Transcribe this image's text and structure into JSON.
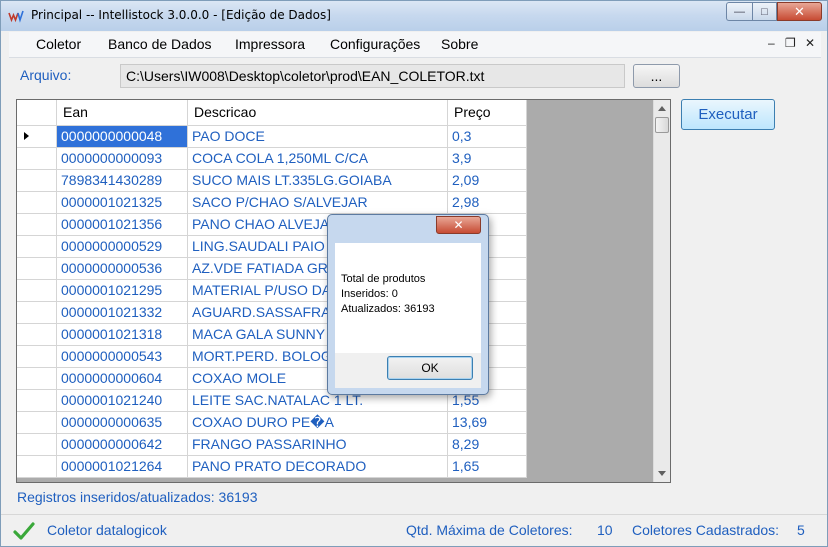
{
  "window": {
    "title": "Principal -- Intellistock 3.0.0.0 - [Edição de Dados]"
  },
  "menu": [
    "Coletor",
    "Banco de Dados",
    "Impressora",
    "Configurações",
    "Sobre"
  ],
  "file": {
    "label": "Arquivo:",
    "path": "C:\\Users\\IW008\\Desktop\\coletor\\prod\\EAN_COLETOR.txt",
    "browse_label": "..."
  },
  "execute_label": "Executar",
  "grid": {
    "columns": [
      "Ean",
      "Descricao",
      "Preço"
    ],
    "rows": [
      {
        "ean": "0000000000048",
        "desc": "PAO DOCE",
        "preco": "0,3"
      },
      {
        "ean": "0000000000093",
        "desc": "COCA COLA 1,250ML C/CA",
        "preco": "3,9"
      },
      {
        "ean": "7898341430289",
        "desc": "SUCO MAIS LT.335LG.GOIABA",
        "preco": "2,09"
      },
      {
        "ean": "0000001021325",
        "desc": "SACO P/CHAO S/ALVEJAR",
        "preco": "2,98"
      },
      {
        "ean": "0000001021356",
        "desc": "PANO CHAO ALVEJA",
        "preco": ""
      },
      {
        "ean": "0000000000529",
        "desc": "LING.SAUDALI PAIO",
        "preco": ""
      },
      {
        "ean": "0000000000536",
        "desc": "AZ.VDE FATIADA GR",
        "preco": ""
      },
      {
        "ean": "0000001021295",
        "desc": "MATERIAL P/USO DA",
        "preco": ""
      },
      {
        "ean": "0000001021332",
        "desc": "AGUARD.SASSAFRAS",
        "preco": ""
      },
      {
        "ean": "0000001021318",
        "desc": "MACA GALA SUNNY",
        "preco": ""
      },
      {
        "ean": "0000000000543",
        "desc": "MORT.PERD. BOLOG",
        "preco": ""
      },
      {
        "ean": "0000000000604",
        "desc": "COXAO MOLE",
        "preco": ""
      },
      {
        "ean": "0000001021240",
        "desc": "LEITE SAC.NATALAC 1 LT.",
        "preco": "1,55"
      },
      {
        "ean": "0000000000635",
        "desc": "COXAO DURO PE�A",
        "preco": "13,69"
      },
      {
        "ean": "0000000000642",
        "desc": "FRANGO PASSARINHO",
        "preco": "8,29"
      },
      {
        "ean": "0000001021264",
        "desc": "PANO PRATO DECORADO",
        "preco": "1,65"
      }
    ]
  },
  "status_records": "Registros inseridos/atualizados: 36193",
  "statusbar": {
    "coletor": "Coletor datalogicok",
    "max_label": "Qtd. Máxima de Coletores:",
    "max_value": "10",
    "reg_label": "Coletores Cadastrados:",
    "reg_value": "5"
  },
  "dialog": {
    "line1": "Total de produtos",
    "line2": "Inseridos: 0",
    "line3": "Atualizados: 36193",
    "ok_label": "OK"
  },
  "colors": {
    "accent_text": "#1f5fbf",
    "selection": "#2f71d9",
    "close_button": "#c74b33"
  }
}
